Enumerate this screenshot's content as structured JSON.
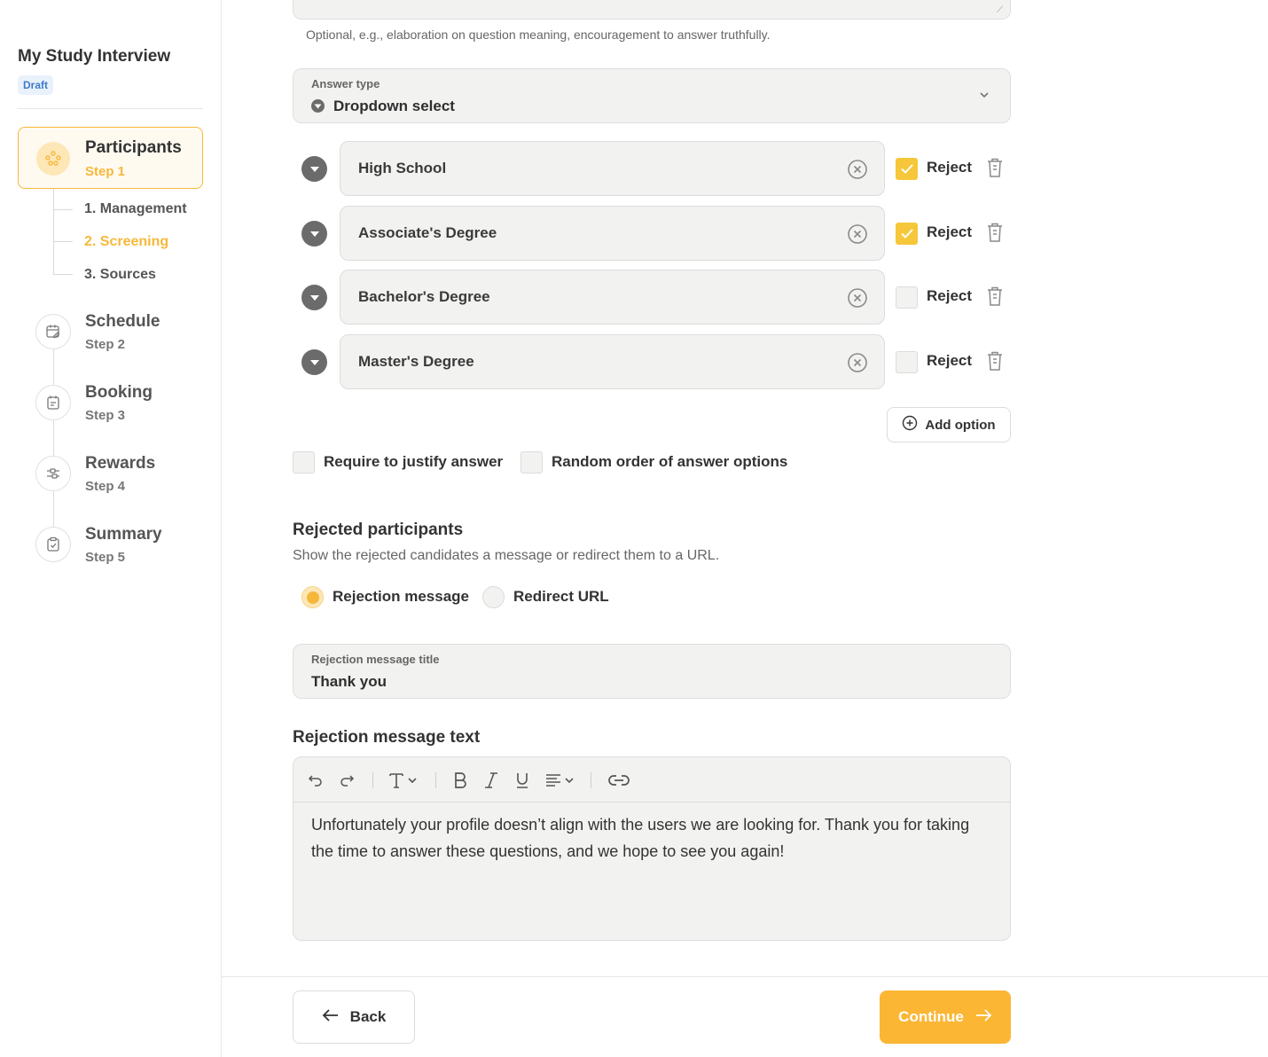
{
  "sidebar": {
    "study_title": "My Study Interview",
    "status_badge": "Draft",
    "active_step": {
      "name": "Participants",
      "number": "Step 1"
    },
    "substeps": [
      {
        "label": "1. Management"
      },
      {
        "label": "2. Screening"
      },
      {
        "label": "3. Sources"
      }
    ],
    "steps": [
      {
        "name": "Schedule",
        "number": "Step 2",
        "icon": "calendar-edit-icon"
      },
      {
        "name": "Booking",
        "number": "Step 3",
        "icon": "calendar-list-icon"
      },
      {
        "name": "Rewards",
        "number": "Step 4",
        "icon": "sliders-icon"
      },
      {
        "name": "Summary",
        "number": "Step 5",
        "icon": "clipboard-check-icon"
      }
    ]
  },
  "question": {
    "hint": "Optional, e.g., elaboration on question meaning, encouragement to answer truthfully.",
    "answer_type_label": "Answer type",
    "answer_type_value": "Dropdown select",
    "options": [
      {
        "text": "High School",
        "reject": true
      },
      {
        "text": "Associate's Degree",
        "reject": true
      },
      {
        "text": "Bachelor's Degree",
        "reject": false
      },
      {
        "text": "Master's Degree",
        "reject": false
      }
    ],
    "reject_label": "Reject",
    "add_option_label": "Add option",
    "require_justify_label": "Require to justify answer",
    "random_order_label": "Random order of answer options"
  },
  "rejected": {
    "title": "Rejected participants",
    "description": "Show the rejected candidates a message or redirect them to a URL.",
    "radio_message": "Rejection message",
    "radio_redirect": "Redirect URL",
    "selected": "Rejection message",
    "message_title_label": "Rejection message title",
    "message_title_value": "Thank you",
    "message_text_heading": "Rejection message text",
    "message_text": "Unfortunately your profile doesn’t align with the users we are looking for. Thank you for taking the time to answer these questions, and we hope to see you again!"
  },
  "footer": {
    "back_label": "Back",
    "continue_label": "Continue"
  },
  "colors": {
    "accent": "#fbb634",
    "checkbox_checked": "#f6c73a",
    "badge_text": "#3f7bc9"
  }
}
